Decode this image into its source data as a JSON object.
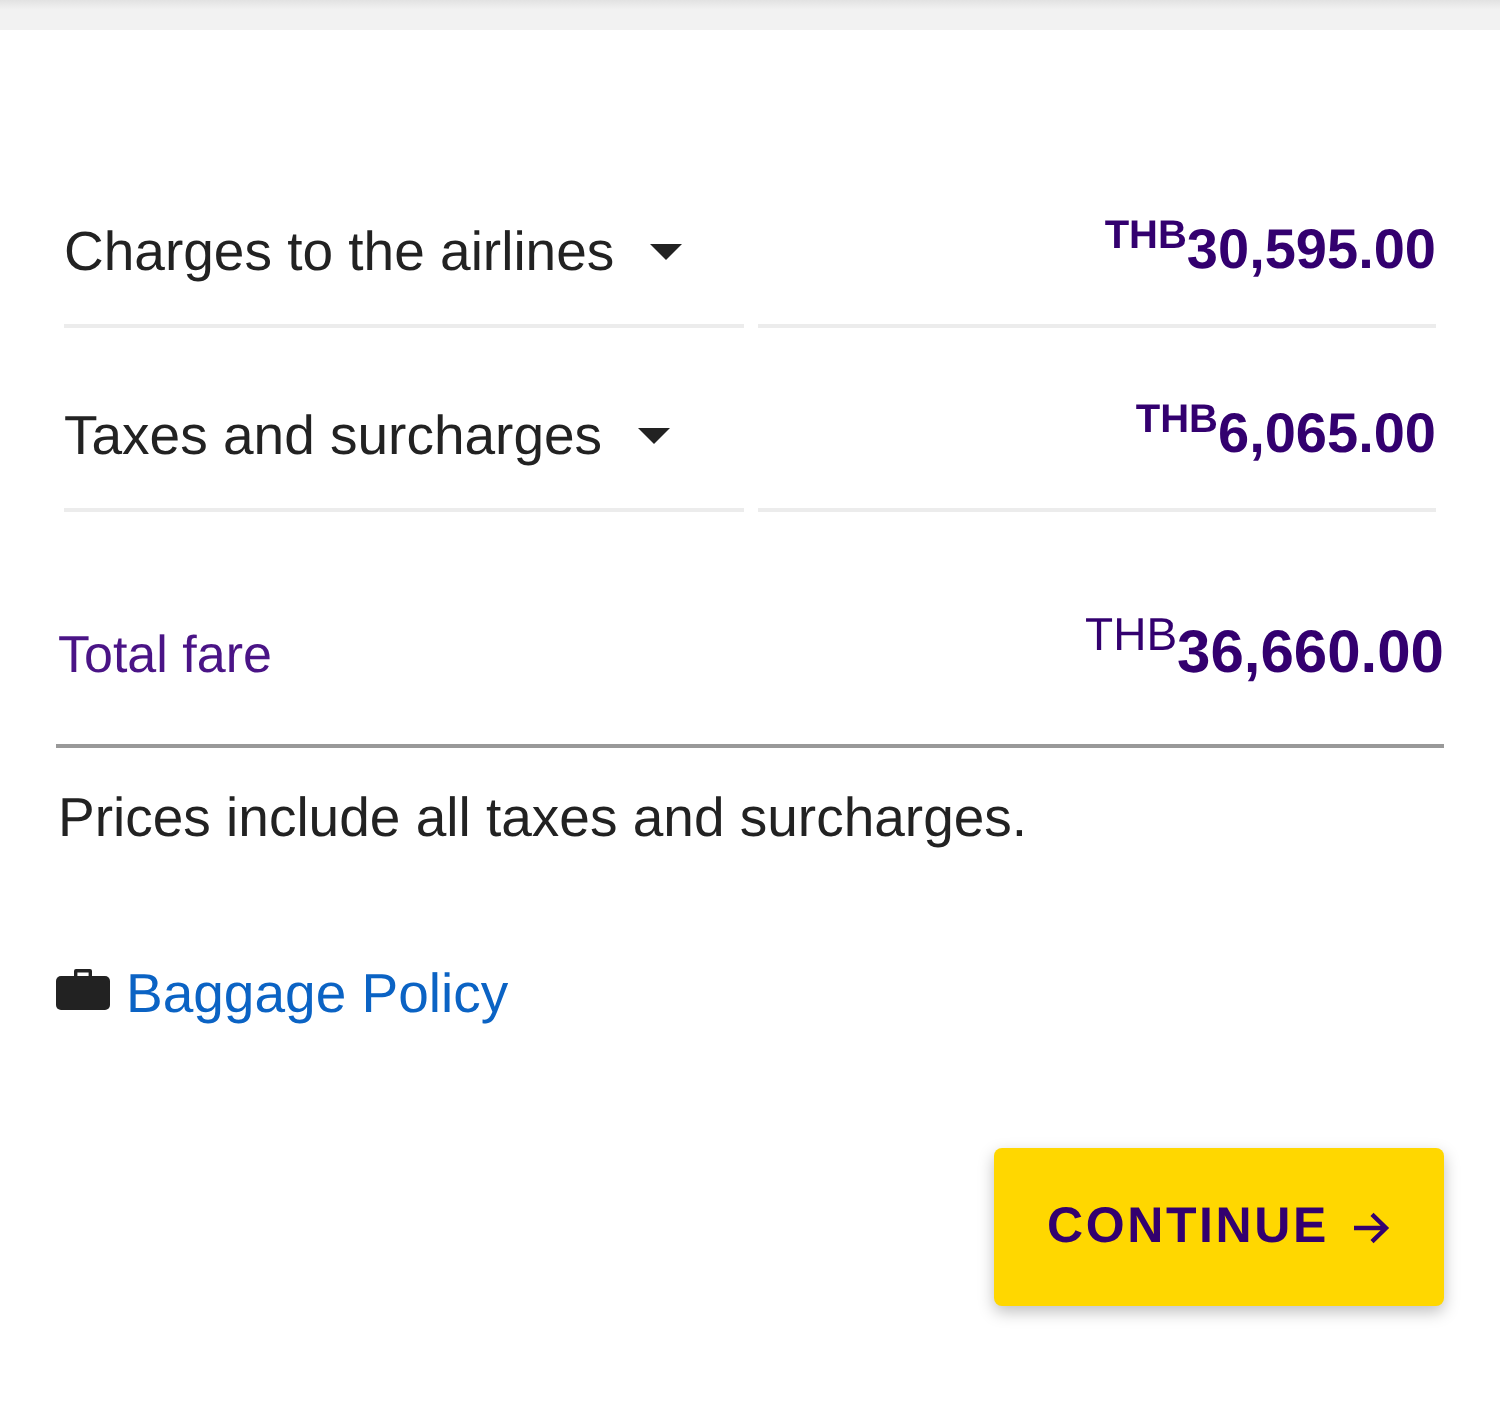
{
  "charges": [
    {
      "label": "Charges to the airlines",
      "expanded": false,
      "amount": "$^{THB}$30,595.00"
    },
    {
      "label": "Taxes and surcharges",
      "expanded": false,
      "amount": "$^{THB}$6,065.00"
    }
  ],
  "total": {
    "label": "Total fare",
    "amount": "$^{THB}$**36,660.00**"
  },
  "note": "Prices include all taxes and surcharges.",
  "baggage_link": {
    "label": "Baggage Policy"
  },
  "continue_button": {
    "label": "CONTINUE"
  }
}
